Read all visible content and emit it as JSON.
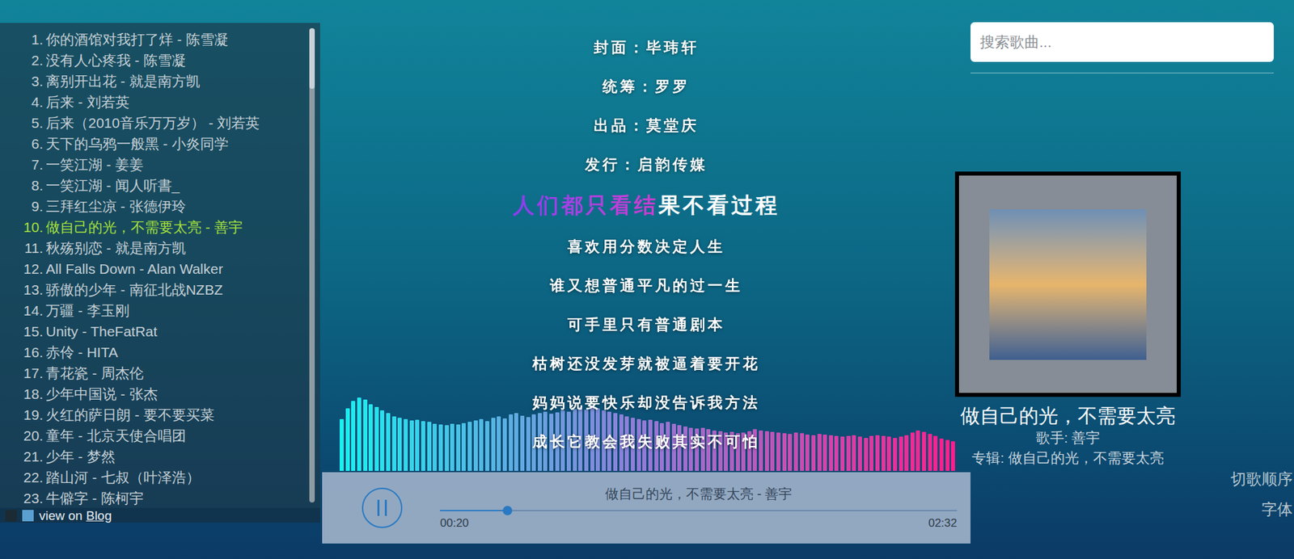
{
  "playlist": {
    "items": [
      {
        "number": "1.",
        "title": "你的酒馆对我打了烊 - 陈雪凝",
        "selected": false
      },
      {
        "number": "2.",
        "title": "没有人心疼我 - 陈雪凝",
        "selected": false
      },
      {
        "number": "3.",
        "title": "离别开出花 - 就是南方凯",
        "selected": false
      },
      {
        "number": "4.",
        "title": "后来 - 刘若英",
        "selected": false
      },
      {
        "number": "5.",
        "title": "后来（2010音乐万万岁） - 刘若英",
        "selected": false
      },
      {
        "number": "6.",
        "title": "天下的乌鸦一般黑 - 小炎同学",
        "selected": false
      },
      {
        "number": "7.",
        "title": "一笑江湖 - 姜姜",
        "selected": false
      },
      {
        "number": "8.",
        "title": "一笑江湖 - 闻人听書_",
        "selected": false
      },
      {
        "number": "9.",
        "title": "三拜红尘凉 - 张德伊玲",
        "selected": false
      },
      {
        "number": "10.",
        "title": "做自己的光，不需要太亮 - 善宇",
        "selected": true
      },
      {
        "number": "11.",
        "title": "秋殇别恋 - 就是南方凯",
        "selected": false
      },
      {
        "number": "12.",
        "title": "All Falls Down - Alan Walker",
        "selected": false
      },
      {
        "number": "13.",
        "title": "骄傲的少年 - 南征北战NZBZ",
        "selected": false
      },
      {
        "number": "14.",
        "title": "万疆 - 李玉刚",
        "selected": false
      },
      {
        "number": "15.",
        "title": "Unity - TheFatRat",
        "selected": false
      },
      {
        "number": "16.",
        "title": "赤伶 - HITA",
        "selected": false
      },
      {
        "number": "17.",
        "title": "青花瓷 - 周杰伦",
        "selected": false
      },
      {
        "number": "18.",
        "title": "少年中国说 - 张杰",
        "selected": false
      },
      {
        "number": "19.",
        "title": "火红的萨日朗 - 要不要买菜",
        "selected": false
      },
      {
        "number": "20.",
        "title": "童年 - 北京天使合唱团",
        "selected": false
      },
      {
        "number": "21.",
        "title": "少年 - 梦然",
        "selected": false
      },
      {
        "number": "22.",
        "title": "踏山河 - 七叔（叶泽浩）",
        "selected": false
      },
      {
        "number": "23.",
        "title": "牛僻字 - 陈柯宇",
        "selected": false
      }
    ]
  },
  "footer": {
    "prefix": "view on",
    "link": "Blog"
  },
  "lyrics": [
    {
      "kind": "line",
      "text": "封面：毕玮轩",
      "active": false
    },
    {
      "kind": "line",
      "text": "统筹：罗罗",
      "active": false
    },
    {
      "kind": "line",
      "text": "出品：莫堂庆",
      "active": false
    },
    {
      "kind": "line",
      "text": "发行：启韵传媒",
      "active": false
    },
    {
      "kind": "current",
      "sung": "人们都只看结",
      "unsung": "果不看过程",
      "active": true
    },
    {
      "kind": "line",
      "text": "喜欢用分数决定人生",
      "active": false
    },
    {
      "kind": "line",
      "text": "谁又想普通平凡的过一生",
      "active": false
    },
    {
      "kind": "line",
      "text": "可手里只有普通剧本",
      "active": false
    },
    {
      "kind": "line",
      "text": "枯树还没发芽就被逼着要开花",
      "active": false
    },
    {
      "kind": "line",
      "text": "妈妈说要快乐却没告诉我方法",
      "active": false
    },
    {
      "kind": "line",
      "text": "成长它教会我失败其实不可怕",
      "active": false
    }
  ],
  "visualizer": {
    "values": [
      70,
      85,
      95,
      99,
      96,
      90,
      86,
      82,
      78,
      74,
      72,
      70,
      68,
      69,
      67,
      66,
      64,
      63,
      62,
      64,
      63,
      65,
      66,
      68,
      70,
      67,
      72,
      74,
      71,
      76,
      78,
      75,
      73,
      76,
      78,
      80,
      77,
      79,
      82,
      80,
      84,
      86,
      83,
      88,
      85,
      82,
      80,
      78,
      76,
      74,
      72,
      70,
      68,
      69,
      67,
      65,
      66,
      64,
      62,
      60,
      58,
      57,
      58,
      56,
      55,
      54,
      52,
      53,
      51,
      52,
      54,
      56,
      55,
      54,
      53,
      52,
      51,
      50,
      52,
      51,
      49,
      48,
      50,
      49,
      48,
      47,
      46,
      47,
      48,
      46,
      45,
      47,
      48,
      47,
      46,
      45,
      46,
      48,
      52,
      55,
      53,
      50,
      47,
      44,
      42,
      40
    ]
  },
  "player": {
    "playing": true,
    "title": "做自己的光，不需要太亮 - 善宇",
    "level": 0.13,
    "elapsed": "00:20",
    "duration": "02:32"
  },
  "search": {
    "placeholder": "搜索歌曲..."
  },
  "now_playing": {
    "title": "做自己的光，不需要太亮",
    "singer": "歌手: 善宇",
    "album": "专辑: 做自己的光，不需要太亮"
  },
  "controls": [
    "切歌顺序",
    "字体"
  ]
}
